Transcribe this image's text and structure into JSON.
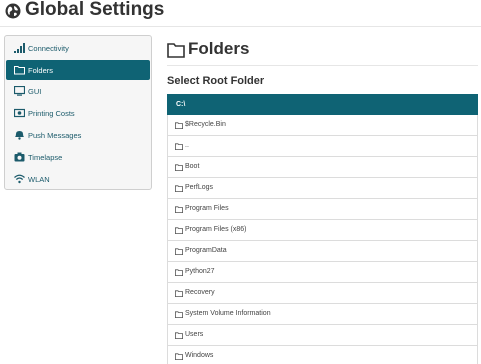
{
  "header": {
    "title": "Global Settings",
    "icon": "globe-icon"
  },
  "sidebar": {
    "items": [
      {
        "label": "Connectivity",
        "icon": "signal-icon",
        "active": false
      },
      {
        "label": "Folders",
        "icon": "folder-icon",
        "active": true
      },
      {
        "label": "GUI",
        "icon": "monitor-icon",
        "active": false
      },
      {
        "label": "Printing Costs",
        "icon": "money-icon",
        "active": false
      },
      {
        "label": "Push Messages",
        "icon": "bell-icon",
        "active": false
      },
      {
        "label": "Timelapse",
        "icon": "camera-icon",
        "active": false
      },
      {
        "label": "WLAN",
        "icon": "wifi-icon",
        "active": false
      }
    ]
  },
  "main": {
    "title": "Folders",
    "section_title": "Select Root Folder",
    "folders": [
      {
        "label": "C:\\",
        "selected": true
      },
      {
        "label": "$Recycle.Bin",
        "selected": false
      },
      {
        "label": "..",
        "selected": false
      },
      {
        "label": "Boot",
        "selected": false
      },
      {
        "label": "PerfLogs",
        "selected": false
      },
      {
        "label": "Program Files",
        "selected": false
      },
      {
        "label": "Program Files (x86)",
        "selected": false
      },
      {
        "label": "ProgramData",
        "selected": false
      },
      {
        "label": "Python27",
        "selected": false
      },
      {
        "label": "Recovery",
        "selected": false
      },
      {
        "label": "System Volume Information",
        "selected": false
      },
      {
        "label": "Users",
        "selected": false
      },
      {
        "label": "Windows",
        "selected": false
      }
    ]
  },
  "colors": {
    "accent": "#0f6374",
    "link": "#1c5b6b",
    "sidebar_bg": "#f6f6f6"
  }
}
